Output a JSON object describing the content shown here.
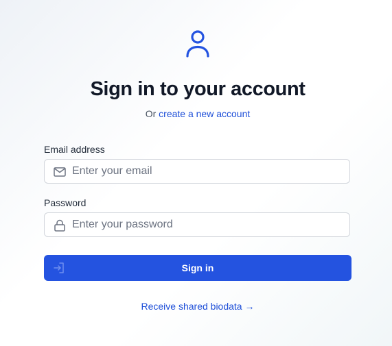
{
  "header": {
    "icon": "user-icon",
    "title": "Sign in to your account",
    "subtitle_prefix": "Or",
    "create_account_link": "create a new account"
  },
  "form": {
    "email": {
      "label": "Email address",
      "placeholder": "Enter your email",
      "value": "",
      "icon": "envelope-icon"
    },
    "password": {
      "label": "Password",
      "placeholder": "Enter your password",
      "value": "",
      "icon": "lock-icon"
    },
    "submit": {
      "label": "Sign in",
      "icon": "login-arrow-icon"
    }
  },
  "footer": {
    "receive_link": "Receive shared biodata →"
  },
  "colors": {
    "accent": "#2453e0",
    "link": "#1d4ed8",
    "title": "#111827",
    "border": "#d1d5db",
    "placeholder": "#6b7280"
  }
}
